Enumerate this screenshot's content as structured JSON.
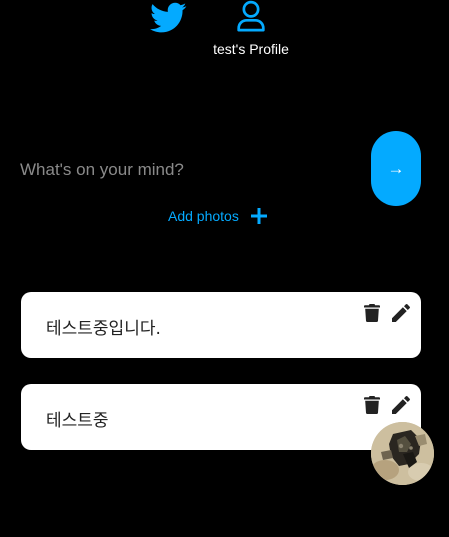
{
  "nav": {
    "home_icon": "twitter-bird-icon",
    "profile_icon": "user-icon",
    "profile_label": "test's Profile"
  },
  "composer": {
    "placeholder": "What's on your mind?",
    "submit_label": "→",
    "add_photos_label": "Add photos",
    "add_photos_icon": "plus-icon"
  },
  "tweets": [
    {
      "text": "테스트중입니다.",
      "delete_icon": "trash-icon",
      "edit_icon": "pencil-icon"
    },
    {
      "text": "테스트중",
      "delete_icon": "trash-icon",
      "edit_icon": "pencil-icon"
    }
  ],
  "colors": {
    "accent": "#04aaff",
    "background": "#000000",
    "card": "#ffffff"
  }
}
